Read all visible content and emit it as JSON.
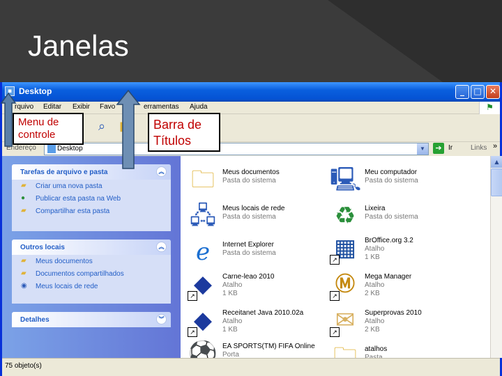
{
  "slide": {
    "title": "Janelas"
  },
  "window": {
    "title": "Desktop",
    "controls": {
      "minimize": "_",
      "maximize": "□",
      "close": "✕"
    },
    "menu": [
      "Arquivo",
      "Editar",
      "Exibir",
      "Favoritos",
      "Ferramentas",
      "Ajuda"
    ],
    "menu_visible": [
      "rquivo",
      "Editar",
      "Exibir",
      "Favo",
      "erramentas",
      "Ajuda"
    ],
    "address": {
      "label": "Endereço",
      "value": "Desktop",
      "go": "Ir",
      "links": "Links"
    },
    "status": "75 objeto(s)"
  },
  "left_pane": {
    "panels": [
      {
        "title": "Tarefas de arquivo e pasta",
        "chevron": "up",
        "items": [
          "Criar uma nova pasta",
          "Publicar esta pasta na Web",
          "Compartilhar esta pasta"
        ]
      },
      {
        "title": "Outros locais",
        "chevron": "up",
        "items": [
          "Meus documentos",
          "Documentos compartilhados",
          "Meus locais de rede"
        ]
      },
      {
        "title": "Detalhes",
        "chevron": "down",
        "items": []
      }
    ]
  },
  "files": [
    {
      "name": "Meus documentos",
      "type": "Pasta do sistema",
      "size": "",
      "icon": "folder-docs-icon",
      "shortcut": false
    },
    {
      "name": "Meu computador",
      "type": "Pasta do sistema",
      "size": "",
      "icon": "computer-icon",
      "shortcut": false
    },
    {
      "name": "Meus locais de rede",
      "type": "Pasta do sistema",
      "size": "",
      "icon": "network-icon",
      "shortcut": false
    },
    {
      "name": "Lixeira",
      "type": "Pasta do sistema",
      "size": "",
      "icon": "recycle-bin-icon",
      "shortcut": false
    },
    {
      "name": "Internet Explorer",
      "type": "Pasta do sistema",
      "size": "",
      "icon": "ie-icon",
      "shortcut": false
    },
    {
      "name": "BrOffice.org 3.2",
      "type": "Atalho",
      "size": "1 KB",
      "icon": "broffice-icon",
      "shortcut": true
    },
    {
      "name": "Carne-leao 2010",
      "type": "Atalho",
      "size": "1 KB",
      "icon": "carne-leao-icon",
      "shortcut": true
    },
    {
      "name": "Mega Manager",
      "type": "Atalho",
      "size": "2 KB",
      "icon": "mega-manager-icon",
      "shortcut": true
    },
    {
      "name": "Receitanet Java 2010.02a",
      "type": "Atalho",
      "size": "1 KB",
      "icon": "receitanet-icon",
      "shortcut": true
    },
    {
      "name": "Superprovas 2010",
      "type": "Atalho",
      "size": "2 KB",
      "icon": "superprovas-icon",
      "shortcut": true
    },
    {
      "name": "EA SPORTS(TM) FIFA Online",
      "type": "Porta",
      "size": "",
      "icon": "fifa-icon",
      "shortcut": false
    },
    {
      "name": "atalhos",
      "type": "Pasta",
      "size": "",
      "icon": "folder-icon",
      "shortcut": false
    }
  ],
  "callouts": {
    "menu": "Menu de controle",
    "titlebar": "Barra de Títulos"
  },
  "colors": {
    "title_bar": "#0553d4",
    "callout_text": "#c00000",
    "pane_blue": "#215dc6"
  }
}
